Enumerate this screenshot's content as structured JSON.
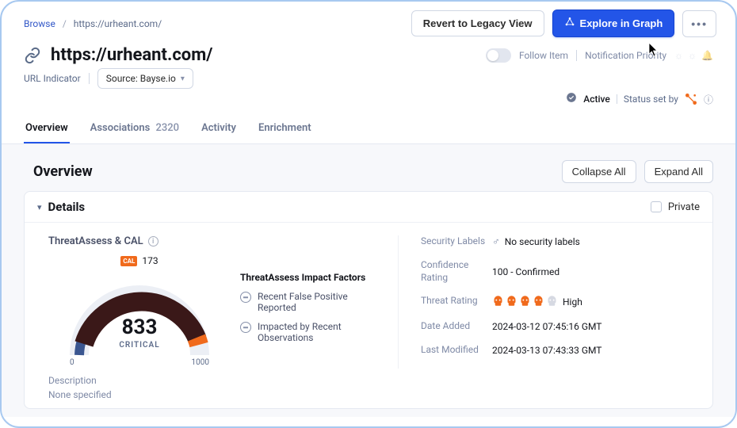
{
  "breadcrumb": {
    "root": "Browse",
    "current": "https://urheant.com/"
  },
  "actions": {
    "revert_label": "Revert to Legacy View",
    "explore_label": "Explore in Graph"
  },
  "page": {
    "title": "https://urheant.com/",
    "type_label": "URL Indicator",
    "source_label": "Source: Bayse.io",
    "follow_label": "Follow Item",
    "notif_label": "Notification Priority"
  },
  "status": {
    "active_label": "Active",
    "set_by_label": "Status set by"
  },
  "tabs": {
    "overview": "Overview",
    "associations": "Associations",
    "associations_count": "2320",
    "activity": "Activity",
    "enrichment": "Enrichment"
  },
  "section": {
    "heading": "Overview",
    "collapse_all": "Collapse All",
    "expand_all": "Expand All"
  },
  "details": {
    "title": "Details",
    "private_label": "Private",
    "threat_assess_heading": "ThreatAssess & CAL",
    "cal_value": "173",
    "gauge": {
      "score": "833",
      "status": "CRITICAL",
      "min": "0",
      "max": "1000"
    },
    "factors_heading": "ThreatAssess Impact Factors",
    "factor1": "Recent False Positive Reported",
    "factor2": "Impacted by Recent Observations",
    "meta": {
      "security_labels_label": "Security Labels",
      "security_labels_value": "No security labels",
      "confidence_label": "Confidence Rating",
      "confidence_value": "100 - Confirmed",
      "threat_label": "Threat Rating",
      "threat_value": "High",
      "date_added_label": "Date Added",
      "date_added_value": "2024-03-12 07:45:16 GMT",
      "last_modified_label": "Last Modified",
      "last_modified_value": "2024-03-13 07:43:33 GMT"
    },
    "description_label": "Description",
    "description_value": "None specified"
  }
}
